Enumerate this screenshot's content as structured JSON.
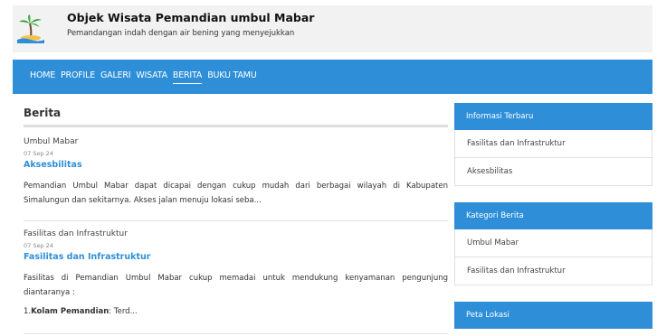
{
  "header": {
    "title": "Objek Wisata Pemandian umbul Mabar",
    "tagline": "Pemandangan indah dengan air bening yang menyejukkan"
  },
  "nav": {
    "items": [
      "HOME",
      "PROFILE",
      "GALERI",
      "WISATA",
      "BERITA",
      "BUKU TAMU"
    ],
    "active": "BERITA"
  },
  "main": {
    "section_title": "Berita",
    "posts": [
      {
        "category": "Umbul Mabar",
        "date": "07 Sep 24",
        "title": "Aksesbilitas",
        "excerpt": "Pemandian Umbul Mabar dapat dicapai dengan cukup mudah dari berbagai wilayah di Kabupaten Simalungun dan sekitarnya. Akses jalan menuju lokasi seba..."
      },
      {
        "category": "Fasilitas dan Infrastruktur",
        "date": "07 Sep 24",
        "title": "Fasilitas dan Infrastruktur",
        "excerpt": "Fasilitas di Pemandian Umbul Mabar cukup memadai untuk mendukung kenyamanan pengunjung diantaranya :",
        "list_prefix": "1.",
        "list_bold": "Kolam Pemandian",
        "list_rest": ": Terd..."
      }
    ]
  },
  "sidebar": {
    "latest": {
      "heading": "Informasi Terbaru",
      "items": [
        "Fasilitas dan Infrastruktur",
        "Aksesbilitas"
      ]
    },
    "categories": {
      "heading": "Kategori Berita",
      "items": [
        "Umbul Mabar",
        "Fasilitas dan Infrastruktur"
      ]
    },
    "map": {
      "heading": "Peta Lokasi"
    }
  },
  "colors": {
    "accent": "#2e8fd8",
    "header_bg": "#f2f2f2"
  }
}
